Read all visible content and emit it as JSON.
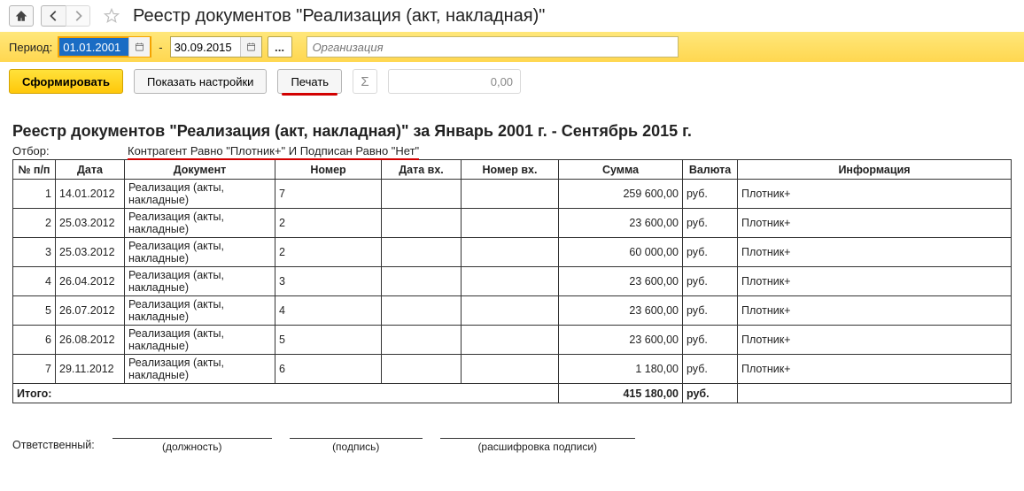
{
  "header": {
    "page_title": "Реестр документов \"Реализация (акт, накладная)\""
  },
  "period_bar": {
    "label": "Период:",
    "date_from": "01.01.2001",
    "date_to": "30.09.2015",
    "dots": "...",
    "org_placeholder": "Организация"
  },
  "toolbar": {
    "form": "Сформировать",
    "show_settings": "Показать настройки",
    "print": "Печать",
    "sigma": "Σ",
    "sum_display": "0,00"
  },
  "report": {
    "title": "Реестр документов \"Реализация (акт, накладная)\"  за Январь 2001 г. - Сентябрь 2015 г.",
    "filter_label": "Отбор:",
    "filter_text": "Контрагент Равно \"Плотник+\" И Подписан Равно \"Нет\"",
    "columns": {
      "num": "№ п/п",
      "date": "Дата",
      "doc": "Документ",
      "no": "Номер",
      "date_in": "Дата вх.",
      "num_in": "Номер вх.",
      "sum": "Сумма",
      "cur": "Валюта",
      "info": "Информация"
    },
    "rows": [
      {
        "n": "1",
        "date": "14.01.2012",
        "doc": "Реализация (акты, накладные)",
        "no": "7",
        "din": "",
        "nin": "",
        "sum": "259 600,00",
        "cur": "руб.",
        "info": "Плотник+"
      },
      {
        "n": "2",
        "date": "25.03.2012",
        "doc": "Реализация (акты, накладные)",
        "no": "2",
        "din": "",
        "nin": "",
        "sum": "23 600,00",
        "cur": "руб.",
        "info": "Плотник+"
      },
      {
        "n": "3",
        "date": "25.03.2012",
        "doc": "Реализация (акты, накладные)",
        "no": "2",
        "din": "",
        "nin": "",
        "sum": "60 000,00",
        "cur": "руб.",
        "info": "Плотник+"
      },
      {
        "n": "4",
        "date": "26.04.2012",
        "doc": "Реализация (акты, накладные)",
        "no": "3",
        "din": "",
        "nin": "",
        "sum": "23 600,00",
        "cur": "руб.",
        "info": "Плотник+"
      },
      {
        "n": "5",
        "date": "26.07.2012",
        "doc": "Реализация (акты, накладные)",
        "no": "4",
        "din": "",
        "nin": "",
        "sum": "23 600,00",
        "cur": "руб.",
        "info": "Плотник+"
      },
      {
        "n": "6",
        "date": "26.08.2012",
        "doc": "Реализация (акты, накладные)",
        "no": "5",
        "din": "",
        "nin": "",
        "sum": "23 600,00",
        "cur": "руб.",
        "info": "Плотник+"
      },
      {
        "n": "7",
        "date": "29.11.2012",
        "doc": "Реализация (акты, накладные)",
        "no": "6",
        "din": "",
        "nin": "",
        "sum": "1 180,00",
        "cur": "руб.",
        "info": "Плотник+"
      }
    ],
    "total_label": "Итого:",
    "total_sum": "415 180,00",
    "total_cur": "руб."
  },
  "signatures": {
    "label": "Ответственный:",
    "slot1": "(должность)",
    "slot2": "(подпись)",
    "slot3": "(расшифровка подписи)"
  }
}
